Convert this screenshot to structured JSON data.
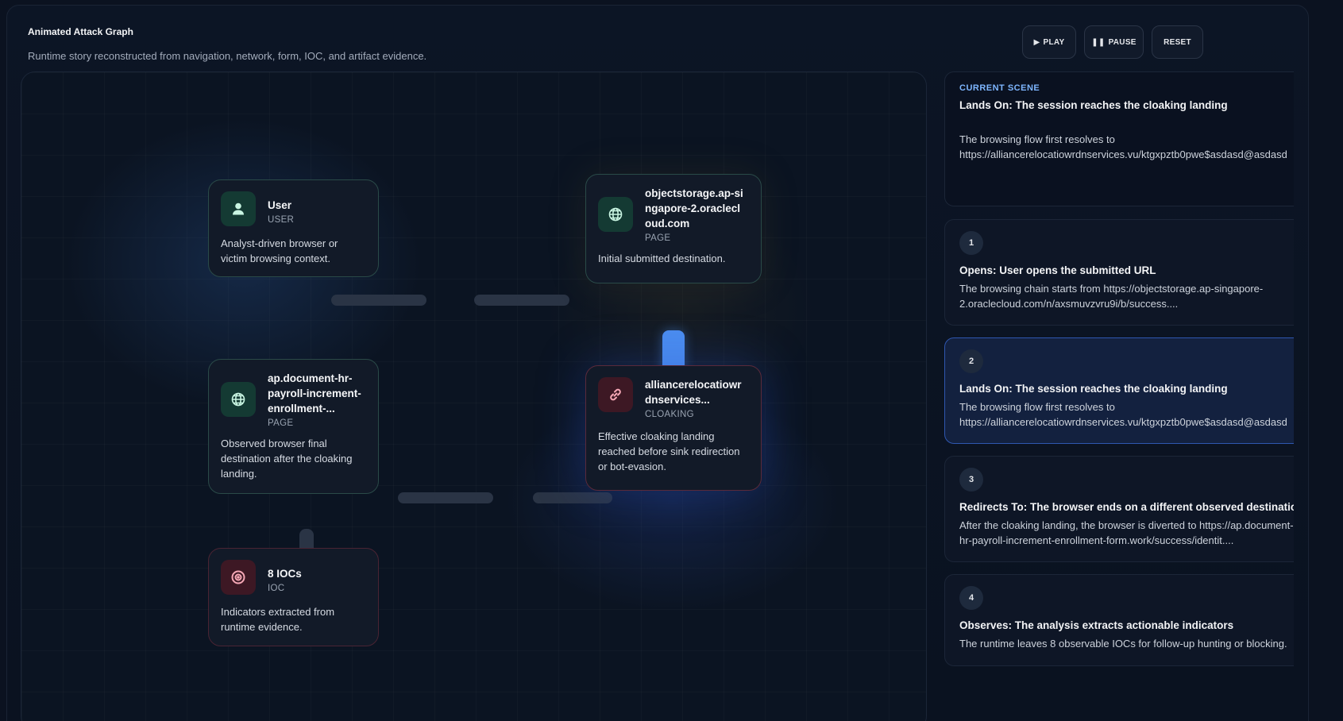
{
  "header": {
    "title": "Animated Attack Graph",
    "subtitle": "Runtime story reconstructed from navigation, network, form, IOC, and artifact evidence."
  },
  "controls": {
    "play_label": "PLAY",
    "pause_label": "PAUSE",
    "reset_label": "RESET"
  },
  "nodes": {
    "user": {
      "title": "User",
      "type": "USER",
      "desc": "Analyst-driven browser or victim browsing context.",
      "icon": "user-icon"
    },
    "page_initial": {
      "title": "objectstorage.ap-singapore-2.oraclecloud.com",
      "type": "PAGE",
      "desc": "Initial submitted destination.",
      "icon": "globe-icon"
    },
    "cloaking": {
      "title": "alliancerelocatiowrdnservices...",
      "type": "CLOAKING",
      "desc": "Effective cloaking landing reached before sink redirection or bot-evasion.",
      "icon": "link-icon"
    },
    "page_final": {
      "title": "ap.document-hr-payroll-increment-enrollment-...",
      "type": "PAGE",
      "desc": "Observed browser final destination after the cloaking landing.",
      "icon": "globe-icon"
    },
    "iocs": {
      "title": "8 IOCs",
      "type": "IOC",
      "desc": "Indicators extracted from runtime evidence.",
      "icon": "target-icon"
    }
  },
  "current_scene": {
    "label": "CURRENT SCENE",
    "title": "Lands On: The session reaches the cloaking landing",
    "body_line1": "The browsing flow first resolves to",
    "body_line2": "https://alliancerelocatiowrdnservices.vu/ktgxpztb0pwe$asdasd@asdasd"
  },
  "steps": [
    {
      "num": "1",
      "title": "Opens: User opens the submitted URL",
      "body": "The browsing chain starts from https://objectstorage.ap-singapore-2.oraclecloud.com/n/axsmuvzvru9i/b/success....",
      "active": false
    },
    {
      "num": "2",
      "title": "Lands On: The session reaches the cloaking landing",
      "body_line1": "The browsing flow first resolves to",
      "body_line2": "https://alliancerelocatiowrdnservices.vu/ktgxpztb0pwe$asdasd@asdasd",
      "active": true
    },
    {
      "num": "3",
      "title": "Redirects To: The browser ends on a different observed destination",
      "body_line1": "After the cloaking landing, the browser is diverted to https://ap.document-",
      "body_line2": "hr-payroll-increment-enrollment-form.work/success/identit....",
      "active": false
    },
    {
      "num": "4",
      "title": "Observes: The analysis extracts actionable indicators",
      "body": "The runtime leaves 8 observable IOCs for follow-up hunting or blocking.",
      "active": false
    }
  ],
  "colors": {
    "accent": "#4b8df0",
    "scene_label": "#7eb6ff",
    "active_card": "#13213f"
  }
}
